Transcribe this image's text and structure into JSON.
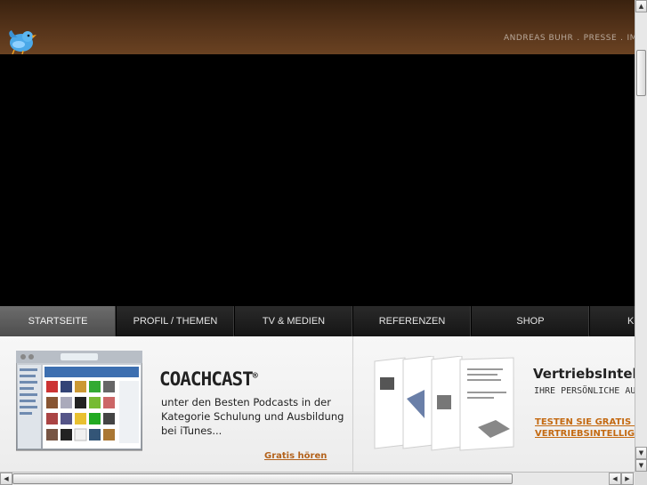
{
  "header": {
    "links": [
      "ANDREAS BUHR",
      "PRESSE",
      "IMPRESSUM"
    ],
    "separator": "."
  },
  "nav": {
    "items": [
      {
        "label": "STARTSEITE",
        "active": true
      },
      {
        "label": "PROFIL / THEMEN",
        "active": false
      },
      {
        "label": "TV & MEDIEN",
        "active": false
      },
      {
        "label": "REFERENZEN",
        "active": false
      },
      {
        "label": "SHOP",
        "active": false
      },
      {
        "label": "KONTAKT",
        "active": false
      }
    ]
  },
  "coachcast": {
    "title": "COACHCAST",
    "trademark": "®",
    "description": "unter den Besten Podcasts in der Kategorie Schulung und Ausbildung bei iTunes...",
    "link": "Gratis hören"
  },
  "vertriebs": {
    "title": "VertriebsIntelligenz",
    "subtitle": "IHRE PERSÖNLICHE AUSGABE",
    "link_line1": "TESTEN SIE GRATIS IHRE",
    "link_line2": "VERTRIEBSINTELLIGENZ"
  },
  "colors": {
    "header_brown": "#56341a",
    "link_orange": "#c46a12",
    "nav_active": "#5e5e5e"
  },
  "icons": {
    "twitter": "twitter-bird-icon"
  }
}
